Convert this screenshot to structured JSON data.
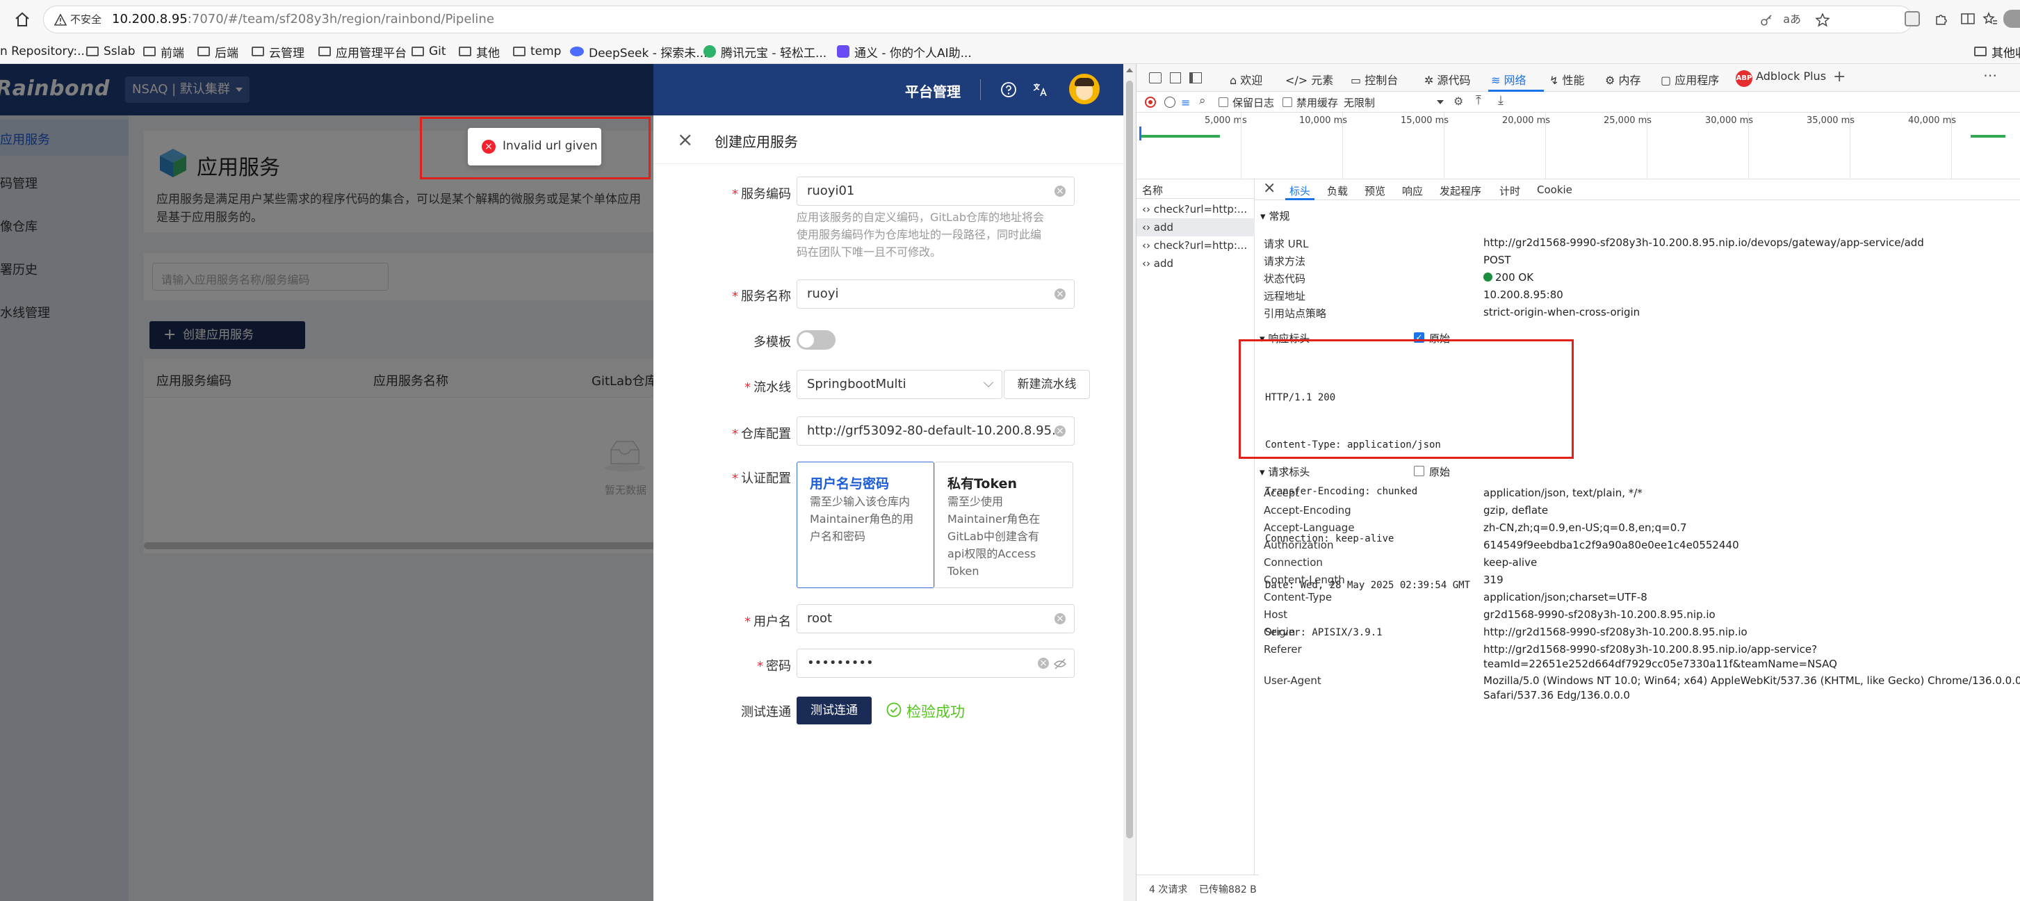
{
  "browser": {
    "security_label": "不安全",
    "url": "10.200.8.95:7070/#/team/sf208y3h/region/rainbond/Pipeline",
    "url_host": "10.200.8.95",
    "url_rest": ":7070/#/team/sf208y3h/region/rainbond/Pipeline",
    "bookmarks": [
      "n Repository:...",
      "Sslab",
      "前端",
      "后端",
      "云管理",
      "应用管理平台",
      "Git",
      "其他",
      "temp",
      "DeepSeek - 探索未...",
      "腾讯元宝 - 轻松工...",
      "通义 - 你的个人AI助..."
    ],
    "bookmarks_right": "其他收"
  },
  "app": {
    "logo": "Rainbond",
    "cluster": "NSAQ | 默认集群",
    "platform_label": "平台管理",
    "sidebar": [
      "应用服务",
      "码管理",
      "像仓库",
      "署历史",
      "水线管理"
    ],
    "page_title": "应用服务",
    "page_desc_1": "应用服务是满足用户某些需求的程序代码的集合，可以是某个解耦的微服务或是某个单体应用",
    "page_desc_2": "是基于应用服务的。",
    "search_placeholder": "请输入应用服务名称/服务编码",
    "create_button": "创建应用服务",
    "columns": [
      "应用服务编码",
      "应用服务名称",
      "GitLab仓库"
    ],
    "empty_text": "暂无数据"
  },
  "toast": {
    "message": "Invalid url given"
  },
  "drawer": {
    "title": "创建应用服务",
    "service_code_label": "服务编码",
    "service_code_value": "ruoyi01",
    "service_code_help": [
      "应用该服务的自定义编码，GitLab仓库的地址将会",
      "使用服务编码作为仓库地址的一段路径，同时此编",
      "码在团队下唯一且不可修改。"
    ],
    "service_name_label": "服务名称",
    "service_name_value": "ruoyi",
    "multi_template_label": "多模板",
    "pipeline_label": "流水线",
    "pipeline_value": "SpringbootMulti",
    "new_pipeline_button": "新建流水线",
    "repo_label": "仓库配置",
    "repo_value": "http://grf53092-80-default-10.200.8.95.nip.i",
    "auth_label": "认证配置",
    "auth_opt1_title": "用户名与密码",
    "auth_opt1_desc": [
      "需至少输入该仓库内",
      "Maintainer角色的用",
      "户名和密码"
    ],
    "auth_opt2_title": "私有Token",
    "auth_opt2_desc": [
      "需至少使用",
      "Maintainer角色在",
      "GitLab中创建含有",
      "api权限的Access",
      "Token"
    ],
    "username_label": "用户名",
    "username_value": "root",
    "password_label": "密码",
    "password_value": "•••••••••",
    "test_label": "测试连通",
    "test_button": "测试连通",
    "test_result": "检验成功"
  },
  "devtools": {
    "tabs": [
      "欢迎",
      "元素",
      "控制台",
      "源代码",
      "网络",
      "性能",
      "内存",
      "应用程序",
      "Adblock Plus"
    ],
    "toolbar": {
      "preserve_log": "保留日志",
      "disable_cache": "禁用缓存",
      "throttle": "无限制"
    },
    "timeline": [
      "5,000 ms",
      "10,000 ms",
      "15,000 ms",
      "20,000 ms",
      "25,000 ms",
      "30,000 ms",
      "35,000 ms",
      "40,000 ms"
    ],
    "name_header": "名称",
    "requests": [
      "check?url=http:...",
      "add",
      "check?url=http:...",
      "add"
    ],
    "detail_tabs": [
      "标头",
      "负载",
      "预览",
      "响应",
      "发起程序",
      "计时",
      "Cookie"
    ],
    "general_title": "常规",
    "general": [
      {
        "k": "请求 URL",
        "v": "http://gr2d1568-9990-sf208y3h-10.200.8.95.nip.io/devops/gateway/app-service/add"
      },
      {
        "k": "请求方法",
        "v": "POST"
      },
      {
        "k": "状态代码",
        "v": "200 OK"
      },
      {
        "k": "远程地址",
        "v": "10.200.8.95:80"
      },
      {
        "k": "引用站点策略",
        "v": "strict-origin-when-cross-origin"
      }
    ],
    "response_headers_title": "响应标头",
    "raw_label": "原始",
    "raw_response": [
      "HTTP/1.1 200",
      "Content-Type: application/json",
      "Transfer-Encoding: chunked",
      "Connection: keep-alive",
      "Date: Wed, 28 May 2025 02:39:54 GMT",
      "Server: APISIX/3.9.1"
    ],
    "request_headers_title": "请求标头",
    "request_headers": [
      {
        "k": "Accept",
        "v": "application/json, text/plain, */*"
      },
      {
        "k": "Accept-Encoding",
        "v": "gzip, deflate"
      },
      {
        "k": "Accept-Language",
        "v": "zh-CN,zh;q=0.9,en-US;q=0.8,en;q=0.7"
      },
      {
        "k": "Authorization",
        "v": "614549f9eebdba1c2f9a90a80e0ee1c4e0552440"
      },
      {
        "k": "Connection",
        "v": "keep-alive"
      },
      {
        "k": "Content-Length",
        "v": "319"
      },
      {
        "k": "Content-Type",
        "v": "application/json;charset=UTF-8"
      },
      {
        "k": "Host",
        "v": "gr2d1568-9990-sf208y3h-10.200.8.95.nip.io"
      },
      {
        "k": "Origin",
        "v": "http://gr2d1568-9990-sf208y3h-10.200.8.95.nip.io"
      },
      {
        "k": "Referer",
        "v": "http://gr2d1568-9990-sf208y3h-10.200.8.95.nip.io/app-service?",
        "v2": "teamId=22651e252d664df7929cc05e7330a11f&teamName=NSAQ"
      },
      {
        "k": "User-Agent",
        "v": "Mozilla/5.0 (Windows NT 10.0; Win64; x64) AppleWebKit/537.36 (KHTML, like Gecko) Chrome/136.0.0.0",
        "v2": "Safari/537.36 Edg/136.0.0.0"
      }
    ],
    "status_bar": {
      "requests": "4 次请求",
      "transferred": "已传输882 B"
    }
  },
  "colors": {
    "header": "#1e3c7a",
    "primary": "#1a2b55",
    "success": "#52c41a",
    "error": "#f5222d",
    "highlight_box": "#e0201b",
    "devtools_active": "#1a73e8"
  }
}
